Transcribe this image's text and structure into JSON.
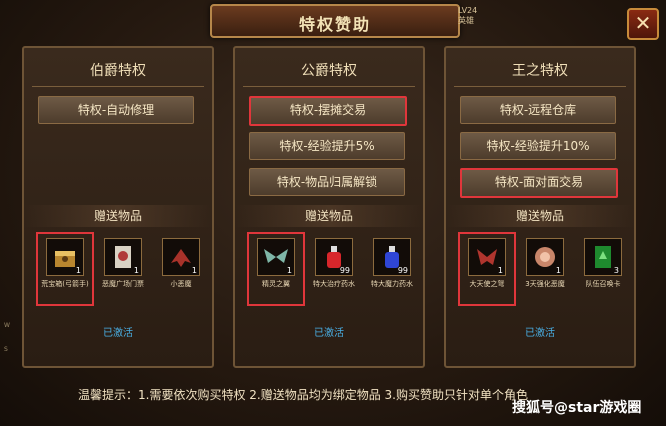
{
  "window": {
    "title": "特权赞助",
    "level_badge": "LV24 英雄",
    "close": "✕"
  },
  "panels": [
    {
      "name": "伯爵特权",
      "privileges": [
        "特权-自动修理"
      ],
      "gift_header": "赠送物品",
      "items": [
        {
          "name": "荒宝箱(弓箭手)",
          "count": "1"
        },
        {
          "name": "恶魔广场门票",
          "count": "1"
        },
        {
          "name": "小恶魔",
          "count": "1"
        }
      ],
      "status": "已激活"
    },
    {
      "name": "公爵特权",
      "privileges": [
        "特权-摆摊交易",
        "特权-经验提升5%",
        "特权-物品归属解锁"
      ],
      "gift_header": "赠送物品",
      "items": [
        {
          "name": "精灵之翼",
          "count": "1"
        },
        {
          "name": "特大治疗药水",
          "count": "99"
        },
        {
          "name": "特大魔力药水",
          "count": "99"
        }
      ],
      "status": "已激活"
    },
    {
      "name": "王之特权",
      "privileges": [
        "特权-远程仓库",
        "特权-经验提升10%",
        "特权-面对面交易"
      ],
      "gift_header": "赠送物品",
      "items": [
        {
          "name": "大天使之弩",
          "count": "1"
        },
        {
          "name": "3天强化恶魔",
          "count": "1"
        },
        {
          "name": "队伍召唤卡",
          "count": "3"
        }
      ],
      "status": "已激活"
    }
  ],
  "tip": "温馨提示：1.需要依次购买特权 2.赠送物品均为绑定物品 3.购买赞助只针对单个角色",
  "watermark": "搜狐号@star游戏圈",
  "side_marks": [
    "W",
    "S"
  ],
  "colors": {
    "highlight": "#e0363b",
    "activated": "#4ab0e6"
  }
}
